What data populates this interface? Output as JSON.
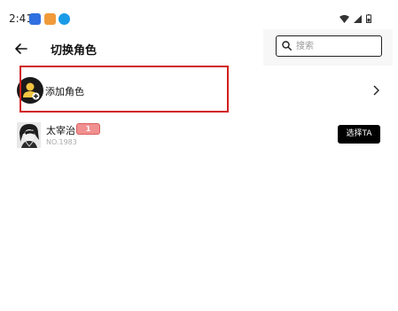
{
  "status_bar": {
    "time": "2:41"
  },
  "header": {
    "title": "切换角色",
    "search_placeholder": "搜索"
  },
  "add_role": {
    "label": "添加角色"
  },
  "roles": [
    {
      "name": "太宰治",
      "badge": "1",
      "number": "NO.1983",
      "select_label": "选择TA"
    }
  ],
  "colors": {
    "highlight_border": "#d21f1f",
    "select_button_bg": "#000000",
    "add_icon_accent": "#f4c542"
  }
}
